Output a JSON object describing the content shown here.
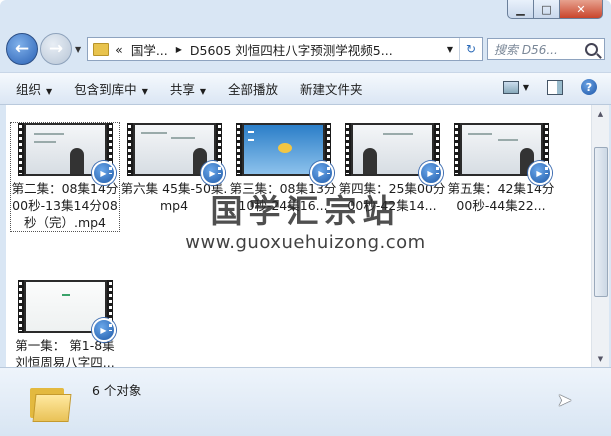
{
  "address": {
    "segments": [
      "«",
      "国学...",
      "D5605 刘恒四柱八字预测学视频5..."
    ],
    "search_placeholder": "搜索 D56..."
  },
  "toolbar": {
    "organize": "组织",
    "include_library": "包含到库中",
    "share": "共享",
    "play_all": "全部播放",
    "new_folder": "新建文件夹"
  },
  "files": [
    {
      "label": "第二集：08集14分00秒-13集14分08秒（完）.mp4",
      "thumb": "lecture"
    },
    {
      "label": "第六集 45集-50集.mp4",
      "thumb": "lecture"
    },
    {
      "label": "第三集：08集13分10秒-24集16...",
      "thumb": "desktop"
    },
    {
      "label": "第四集：25集00分00秒-42集14...",
      "thumb": "lecture"
    },
    {
      "label": "第五集：42集14分00秒-44集22...",
      "thumb": "lecture"
    },
    {
      "label": "第一集： 第1-8集刘恒周易八字四...",
      "thumb": "blank"
    }
  ],
  "watermark": {
    "text": "国学汇宗站",
    "url": "www.guoxuehuizong.com"
  },
  "status": {
    "count": "6 个对象"
  }
}
